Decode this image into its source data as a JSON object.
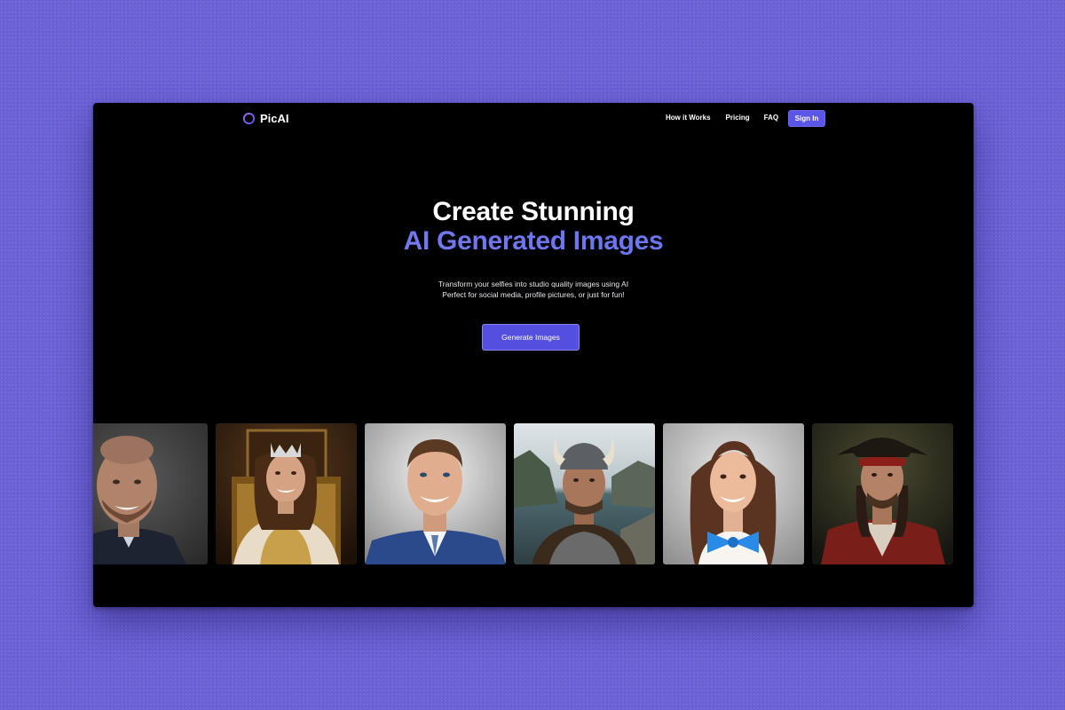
{
  "brand": {
    "name": "PicAI",
    "accent": "#5b55e8"
  },
  "nav": {
    "links": [
      "How it Works",
      "Pricing",
      "FAQ"
    ],
    "signin_label": "Sign In"
  },
  "hero": {
    "title_line1": "Create Stunning",
    "title_line2": "AI Generated Images",
    "subtitle_line1": "Transform your selfies into studio quality images using AI",
    "subtitle_line2": "Perfect for social media, profile pictures, or just for fun!",
    "cta_label": "Generate Images"
  },
  "gallery": {
    "images": [
      {
        "subject": "businessman-portrait"
      },
      {
        "subject": "queen-portrait"
      },
      {
        "subject": "professional-headshot"
      },
      {
        "subject": "viking-portrait"
      },
      {
        "subject": "woman-blue-bow-portrait"
      },
      {
        "subject": "pirate-portrait"
      }
    ]
  }
}
